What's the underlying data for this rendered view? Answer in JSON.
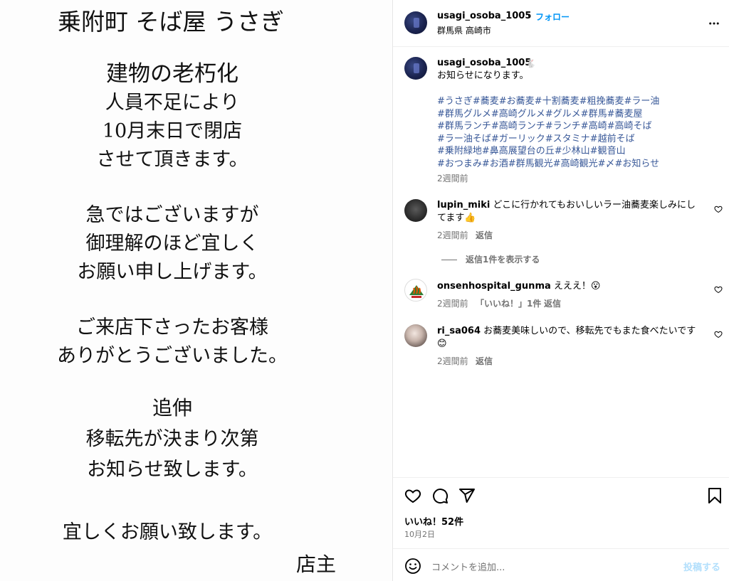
{
  "post_image": {
    "lines": [
      "乗附町 そば屋 うさぎ",
      "建物の老朽化",
      "人員不足により",
      "10月末日で閉店",
      "させて頂きます。",
      "急ではございますが",
      "御理解のほど宜しく",
      "お願い申し上げます。",
      "ご来店下さったお客様",
      "ありがとうございました。",
      "追伸",
      "移転先が決まり次第",
      "お知らせ致します。",
      "宜しくお願い致します。",
      "店主"
    ]
  },
  "header": {
    "username": "usagi_osoba_1005",
    "separator": "•",
    "follow_label": "フォロー",
    "location": "群馬県 高崎市",
    "more_icon": "more-horizontal-icon"
  },
  "caption": {
    "username": "usagi_osoba_1005",
    "emoji": "🐇",
    "text": "お知らせになります。",
    "hashtag_lines": [
      "#うさぎ#蕎麦#お蕎麦#十割蕎麦#粗挽蕎麦#ラー油",
      "#群馬グルメ#高崎グルメ#グルメ#群馬#蕎麦屋",
      "#群馬ランチ#高崎ランチ#ランチ#高崎#高崎そば",
      "#ラー油そば#ガーリック#スタミナ#越前そば",
      "#乗附緑地#鼻高展望台の丘#少林山#観音山",
      "#おつまみ#お酒#群馬観光#高崎観光#〆#お知らせ"
    ],
    "time": "2週間前"
  },
  "comments": [
    {
      "username": "lupin_miki",
      "text_line1": "どこに行かれてもおいしいラー油蕎麦楽しみにし",
      "text_line2": "てます👍",
      "time": "2週間前",
      "reply_label": "返信",
      "view_replies": "返信1件を表示する"
    },
    {
      "username": "onsenhospital_gunma",
      "text": "えええ！😮",
      "time": "2週間前",
      "likes_label": "「いいね！」1件",
      "reply_label": "返信"
    },
    {
      "username": "ri_sa064",
      "text_line1": "お蕎麦美味しいので、移転先でもまた食べたいです",
      "text_line2": "😊",
      "time": "2週間前",
      "reply_label": "返信"
    }
  ],
  "actions": {
    "like_icon": "heart-icon",
    "comment_icon": "comment-icon",
    "share_icon": "share-icon",
    "save_icon": "bookmark-icon",
    "likes_text": "いいね！52件",
    "date": "10月2日"
  },
  "comment_input": {
    "emoji_icon": "emoji-icon",
    "placeholder": "コメントを追加...",
    "post_label": "投稿する",
    "post_color": "#b2dffc"
  },
  "colors": {
    "hashtag": "#385898",
    "follow": "#0095f6",
    "muted": "#737373"
  }
}
